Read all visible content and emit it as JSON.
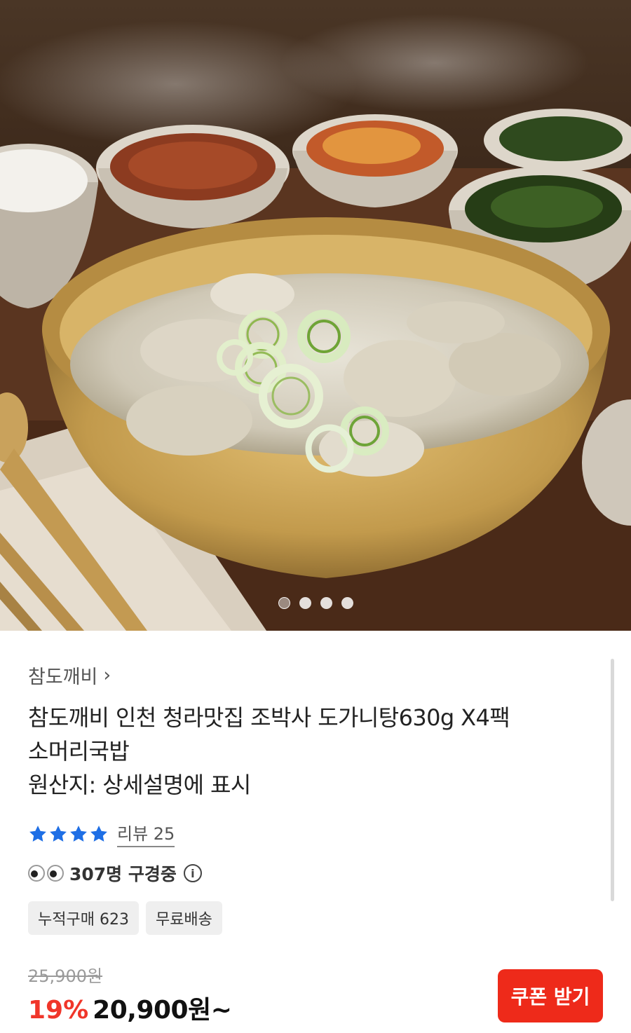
{
  "hero": {
    "image_alt": "도가니탕",
    "slide_count": 4,
    "active_slide": 1
  },
  "product": {
    "brand": "참도깨비",
    "brand_chevron": "›",
    "title_line1": "참도깨비 인천 청라맛집 조박사 도가니탕630g X4팩",
    "title_line2": "소머리국밥",
    "title_line3": "원산지: 상세설명에 표시",
    "rating_stars": 4,
    "review_label": "리뷰 25",
    "viewing_text": "307명 구경중",
    "info_icon": "i",
    "chips": [
      "누적구매 623",
      "무료배송"
    ],
    "original_price": "25,900원",
    "discount": "19%",
    "price": "20,900원~",
    "coupon_button": "쿠폰 받기"
  },
  "colors": {
    "accent_red": "#ee2a1a",
    "discount_red": "#f0362a",
    "star_blue": "#1f6fe5"
  }
}
